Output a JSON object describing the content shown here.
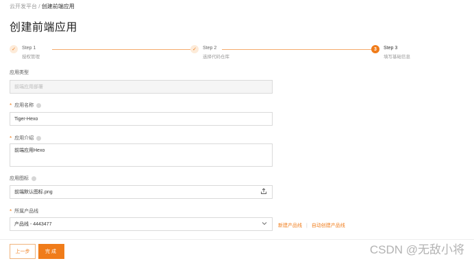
{
  "breadcrumb": {
    "parent": "云开发平台",
    "separator": "/",
    "current": "创建前端应用"
  },
  "page_title": "创建前端应用",
  "steps": [
    {
      "num": "1",
      "title": "Step 1",
      "desc": "授权管理",
      "status": "done"
    },
    {
      "num": "2",
      "title": "Step 2",
      "desc": "选择代码仓库",
      "status": "done"
    },
    {
      "num": "3",
      "title": "Step 3",
      "desc": "填写基础信息",
      "status": "active"
    }
  ],
  "check_glyph": "✓",
  "form": {
    "app_type": {
      "label": "应用类型",
      "placeholder": "前端应用部署"
    },
    "app_name": {
      "required_mark": "*",
      "label": "应用名称",
      "value": "Tiger-Hexo"
    },
    "app_intro": {
      "required_mark": "*",
      "label": "应用介绍",
      "value": "前端应用Hexo"
    },
    "app_icon": {
      "label": "应用图标",
      "value": "前端默认图标.png"
    },
    "product_line": {
      "required_mark": "*",
      "label": "所属产品线",
      "value": "产品线 - 4443477",
      "new_link": "新建产品线",
      "link_separator": "|",
      "auto_link": "自动创建产品线"
    }
  },
  "buttons": {
    "prev": "上一步",
    "finish": "完成"
  },
  "watermark": "CSDN @无敌小将",
  "colors": {
    "accent": "#f07c1a",
    "accent_light": "#fdebd9"
  }
}
